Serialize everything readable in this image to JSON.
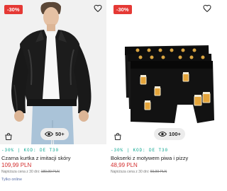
{
  "products": [
    {
      "discount_badge": "-30%",
      "views": "50+",
      "promo": "-30% | KOD: DE T30",
      "name": "Czarna kurtka z imitacji skóry",
      "price": "109,99 PLN",
      "lowest_label": "Najniższa cena z 30 dni: ",
      "lowest_value": "189,99 PLN",
      "more_label": "Tylko online"
    },
    {
      "discount_badge": "-30%",
      "views": "100+",
      "promo": "-30% | KOD: DE T30",
      "name": "Bokserki z motywem piwa i pizzy",
      "price": "48,99 PLN",
      "lowest_label": "Najniższa cena z 30 dni: ",
      "lowest_value": "69,99 PLN"
    }
  ],
  "colors": {
    "badge": "#e53935",
    "price": "#d32f2f",
    "promo": "#0aa58f"
  }
}
